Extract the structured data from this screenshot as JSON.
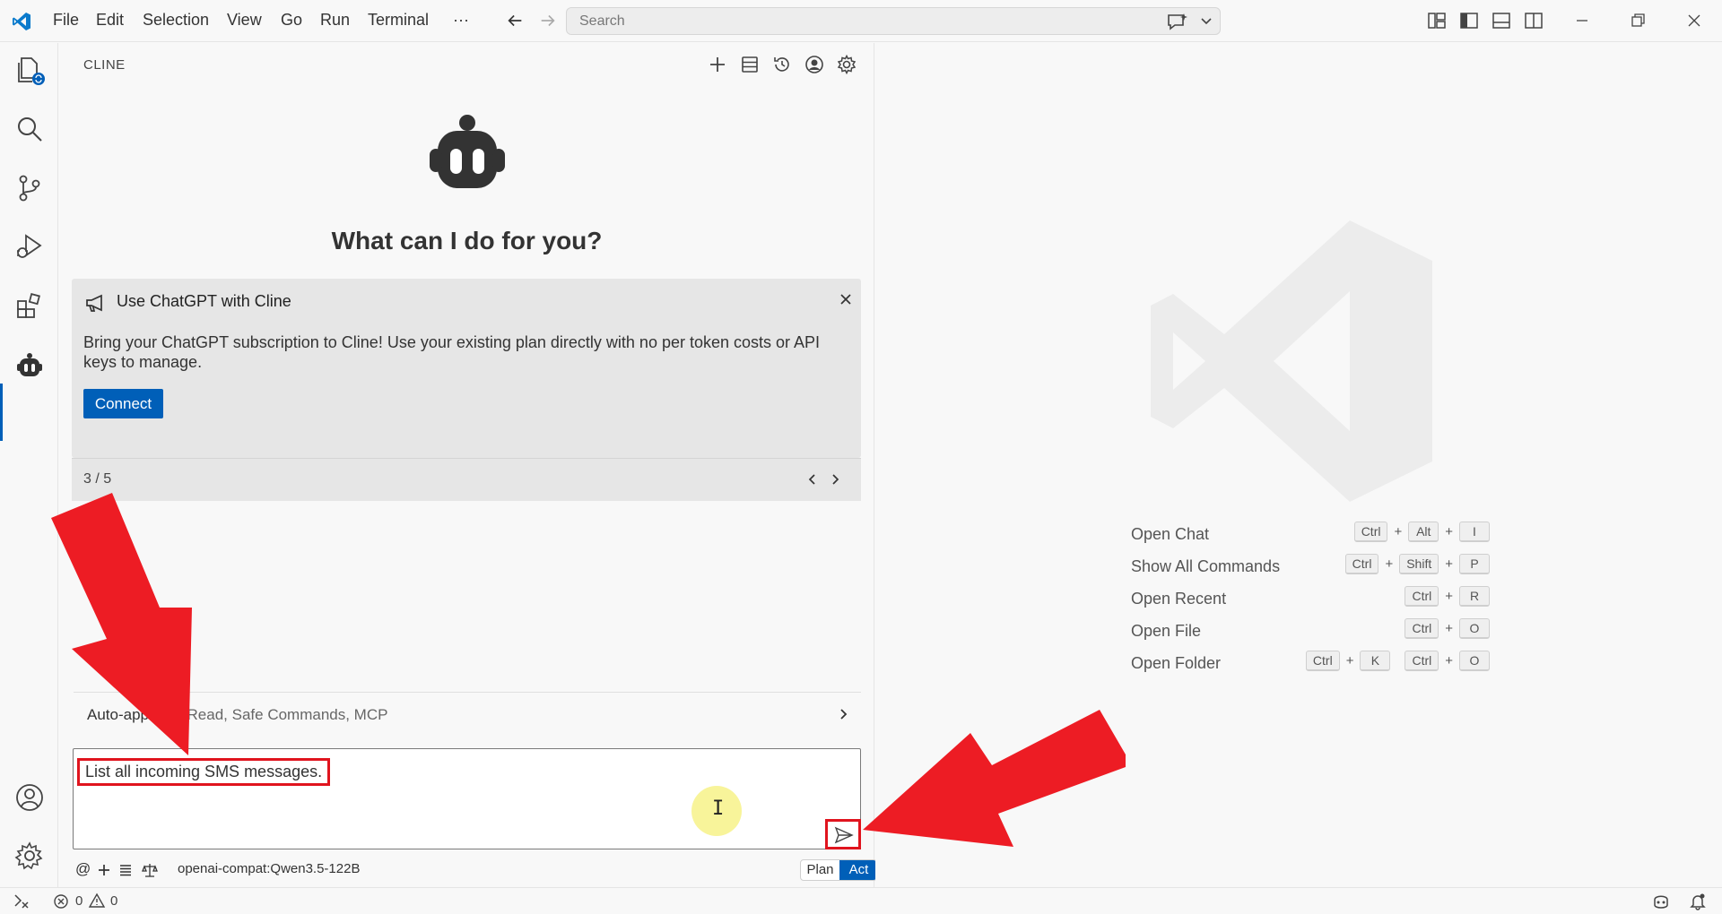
{
  "menu": {
    "file": "File",
    "edit": "Edit",
    "selection": "Selection",
    "view": "View",
    "go": "Go",
    "run": "Run",
    "terminal": "Terminal",
    "more": "···"
  },
  "search": {
    "placeholder": "Search"
  },
  "panel": {
    "title": "CLINE",
    "hero_title": "What can I do for you?"
  },
  "announcement": {
    "title": "Use ChatGPT with Cline",
    "body": "Bring your ChatGPT subscription to Cline! Use your existing plan directly with no per token costs or API keys to manage.",
    "button": "Connect",
    "pager": "3 / 5"
  },
  "auto_approve": {
    "label": "Auto-approve:",
    "value": "Read, Safe Commands, MCP"
  },
  "chat": {
    "input_value": "List all incoming SMS messages.",
    "model": "openai-compat:Qwen3.5-122B",
    "mode_plan": "Plan",
    "mode_act": "Act",
    "active_mode": "Act"
  },
  "shortcuts": [
    {
      "label": "Open Chat",
      "keys": [
        [
          "Ctrl",
          "Alt",
          "I"
        ]
      ]
    },
    {
      "label": "Show All Commands",
      "keys": [
        [
          "Ctrl",
          "Shift",
          "P"
        ]
      ]
    },
    {
      "label": "Open Recent",
      "keys": [
        [
          "Ctrl",
          "R"
        ]
      ]
    },
    {
      "label": "Open File",
      "keys": [
        [
          "Ctrl",
          "O"
        ]
      ]
    },
    {
      "label": "Open Folder",
      "keys": [
        [
          "Ctrl",
          "K"
        ],
        [
          "Ctrl",
          "O"
        ]
      ]
    }
  ],
  "status": {
    "errors": "0",
    "warnings": "0"
  },
  "colors": {
    "accent": "#005fb8",
    "annotation_red": "#e0141e"
  }
}
